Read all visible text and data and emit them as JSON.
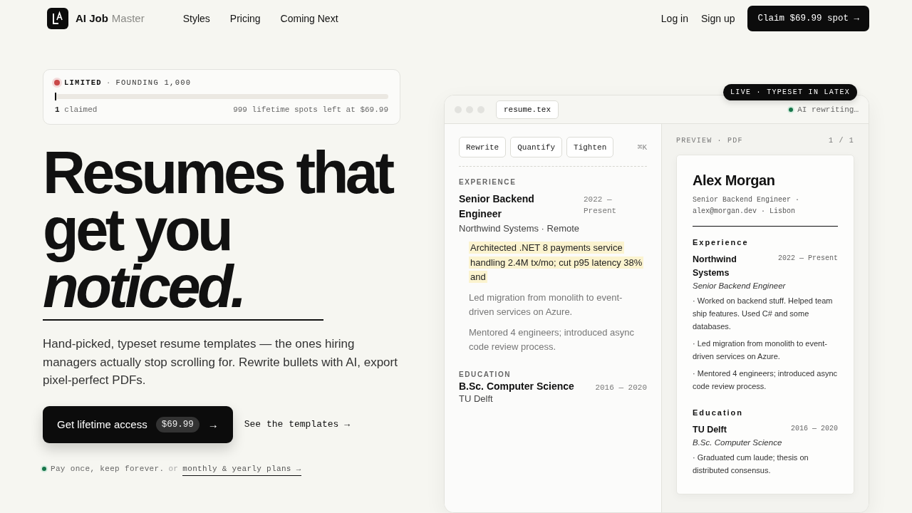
{
  "nav": {
    "brand": {
      "name": "AI Job",
      "suffix": "Master"
    },
    "links": [
      "Styles",
      "Pricing",
      "Coming Next"
    ],
    "auth": [
      "Log in",
      "Sign up"
    ],
    "cta": "Claim $69.99 spot →"
  },
  "founding": {
    "badge": "LIMITED",
    "separator": "·",
    "label": "FOUNDING 1,000",
    "level": 0.001,
    "count": "1",
    "count_label": "claimed",
    "remaining": "999 lifetime spots left at $69.99"
  },
  "hero": {
    "lines": [
      "Resumes that",
      "get you"
    ],
    "emphasis": "noticed.",
    "description": "Hand-picked, typeset resume templates — the ones hiring managers actually stop scrolling for. Rewrite bullets with AI, export pixel-perfect PDFs.",
    "primary": {
      "label": "Get lifetime access",
      "price": "$69.99",
      "arrow": "→"
    },
    "secondary": "See the templates →",
    "footnote": {
      "text": "Pay once, keep forever.",
      "or": "or",
      "link": "monthly & yearly plans →"
    }
  },
  "editor": {
    "badge": "LIVE · TYPESET IN LATEX",
    "tab": "resume.tex",
    "status": "AI rewriting…",
    "actions": [
      "Rewrite",
      "Quantify",
      "Tighten"
    ],
    "shortcut": "⌘K",
    "experience": {
      "heading": "EXPERIENCE",
      "title": "Senior Backend Engineer",
      "dates": "2022 — Present",
      "company": "Northwind Systems · Remote",
      "bullets": [
        {
          "text": "Architected .NET 8 payments service handling 2.4M tx/mo; cut p95 latency 38% and",
          "highlighted": true
        },
        {
          "text": "Led migration from monolith to event-driven services on Azure.",
          "highlighted": false
        },
        {
          "text": "Mentored 4 engineers; introduced async code review process.",
          "highlighted": false
        }
      ]
    },
    "education": {
      "heading": "EDUCATION",
      "degree": "B.Sc. Computer Science",
      "dates": "2016 — 2020",
      "school": "TU Delft"
    }
  },
  "preview": {
    "label": "PREVIEW · PDF",
    "page": "1 / 1",
    "name": "Alex Morgan",
    "contact": "Senior Backend Engineer · alex@morgan.dev · Lisbon",
    "sections": [
      {
        "heading": "Experience",
        "org": "Northwind Systems",
        "dates": "2022 — Present",
        "role": "Senior Backend Engineer",
        "bullets": [
          "· Worked on backend stuff. Helped team ship features. Used C# and some databases.",
          "· Led migration from monolith to event-driven services on Azure.",
          "· Mentored 4 engineers; introduced async code review process."
        ]
      },
      {
        "heading": "Education",
        "org": "TU Delft",
        "dates": "2016 — 2020",
        "role": "B.Sc. Computer Science",
        "bullets": [
          "· Graduated cum laude; thesis on distributed consensus."
        ]
      }
    ]
  }
}
